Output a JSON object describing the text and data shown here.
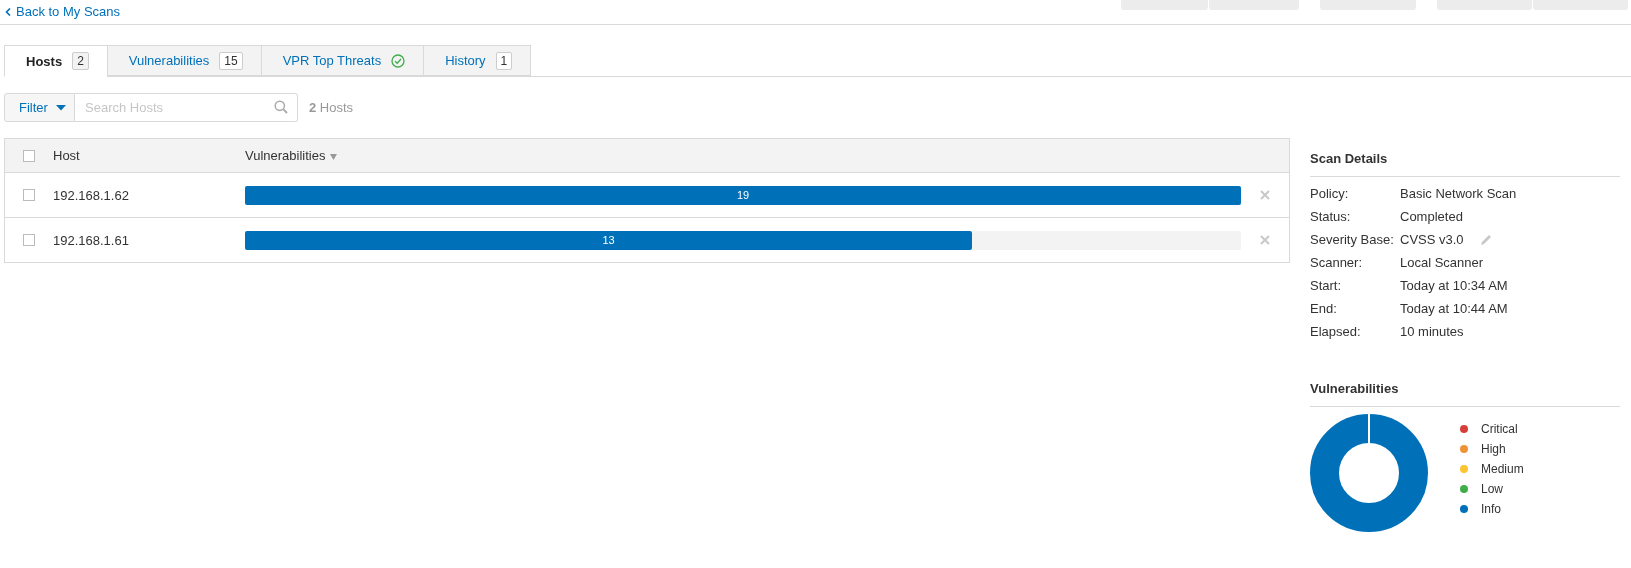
{
  "back_link": "Back to My Scans",
  "tabs": [
    {
      "label": "Hosts",
      "count": "2",
      "selected": true
    },
    {
      "label": "Vulnerabilities",
      "count": "15",
      "selected": false
    },
    {
      "label": "VPR Top Threats",
      "check": true,
      "selected": false
    },
    {
      "label": "History",
      "count": "1",
      "selected": false
    }
  ],
  "filter": {
    "label": "Filter",
    "search_placeholder": "Search Hosts",
    "result_count": "2",
    "result_label": "Hosts"
  },
  "table": {
    "columns": [
      {
        "label": "Host",
        "sorted": false
      },
      {
        "label": "Vulnerabilities",
        "sorted": true
      }
    ],
    "header_checked": false,
    "rows": [
      {
        "host": "192.168.1.62",
        "checked": false,
        "count": "19",
        "level": 1.0
      },
      {
        "host": "192.168.1.61",
        "checked": false,
        "count": "13",
        "level": 0.73
      }
    ]
  },
  "scan_details": {
    "title": "Scan Details",
    "fields": [
      {
        "label": "Policy:",
        "value": "Basic Network Scan"
      },
      {
        "label": "Status:",
        "value": "Completed"
      },
      {
        "label": "Severity Base:",
        "value": "CVSS v3.0",
        "editable": true
      },
      {
        "label": "Scanner:",
        "value": "Local Scanner"
      },
      {
        "label": "Start:",
        "value": "Today at 10:34 AM"
      },
      {
        "label": "End:",
        "value": "Today at 10:44 AM"
      },
      {
        "label": "Elapsed:",
        "value": "10 minutes"
      }
    ]
  },
  "vulnerabilities": {
    "title": "Vulnerabilities",
    "legend": [
      {
        "label": "Critical",
        "color": "#d43f3a"
      },
      {
        "label": "High",
        "color": "#ee9336"
      },
      {
        "label": "Medium",
        "color": "#fdc431"
      },
      {
        "label": "Low",
        "color": "#3fae49"
      },
      {
        "label": "Info",
        "color": "#0071b9"
      }
    ]
  }
}
